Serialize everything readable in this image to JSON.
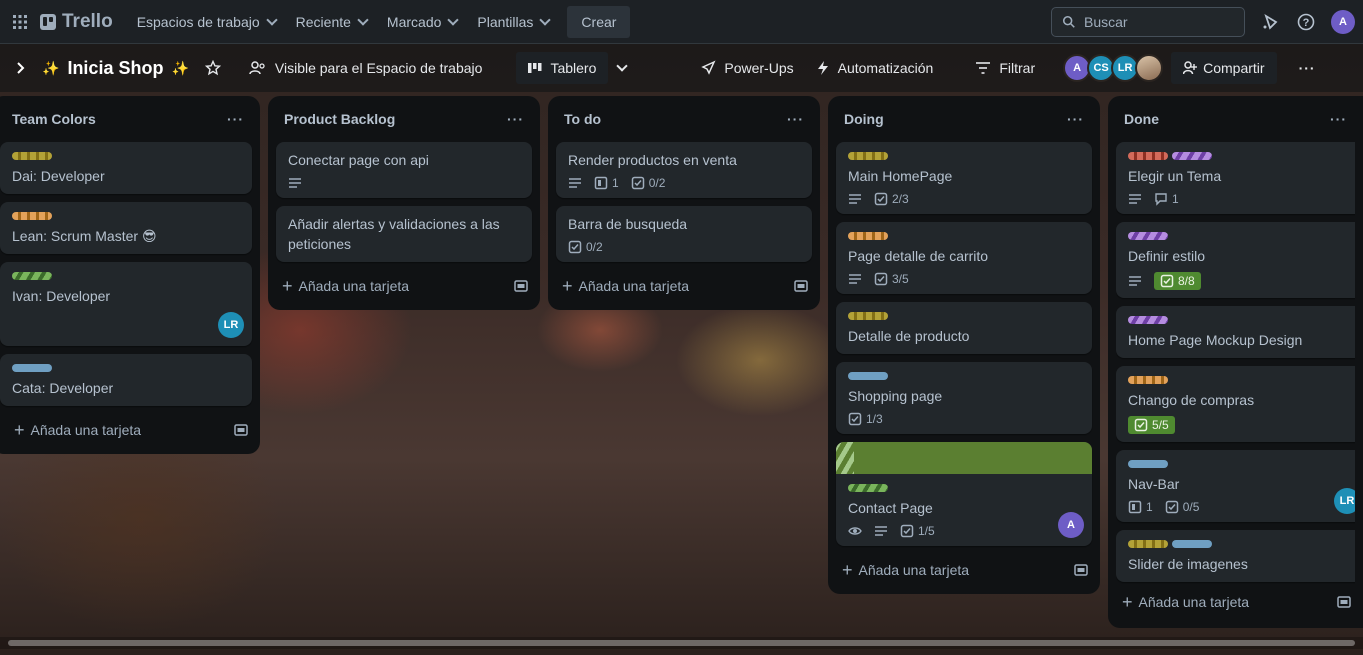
{
  "topnav": {
    "brand": "Trello",
    "menus": [
      "Espacios de trabajo",
      "Reciente",
      "Marcado",
      "Plantillas"
    ],
    "create_label": "Crear",
    "search_placeholder": "Buscar",
    "user_initial": "A"
  },
  "board": {
    "title": "Inicia Shop",
    "visibility_label": "Visible para el Espacio de trabajo",
    "view_label": "Tablero",
    "powerups_label": "Power-Ups",
    "automation_label": "Automatización",
    "filter_label": "Filtrar",
    "share_label": "Compartir",
    "members": [
      "A",
      "CS",
      "LR"
    ]
  },
  "add_card_label": "Añada una tarjeta",
  "lists": [
    {
      "title": "Team Colors",
      "cards": [
        {
          "title": "Dai: Developer"
        },
        {
          "title": "Lean: Scrum Master 😎"
        },
        {
          "title": "Ivan: Developer",
          "member": "LR"
        },
        {
          "title": "Cata: Developer"
        }
      ]
    },
    {
      "title": "Product Backlog",
      "cards": [
        {
          "title": "Conectar page con api"
        },
        {
          "title": "Añadir alertas y validaciones a las peticiones"
        }
      ]
    },
    {
      "title": "To do",
      "cards": [
        {
          "title": "Render productos en venta",
          "attachments": "1",
          "checklist": "0/2"
        },
        {
          "title": "Barra de busqueda",
          "checklist": "0/2"
        }
      ]
    },
    {
      "title": "Doing",
      "cards": [
        {
          "title": "Main HomePage",
          "checklist": "2/3"
        },
        {
          "title": "Page detalle de carrito",
          "checklist": "3/5"
        },
        {
          "title": "Detalle de producto"
        },
        {
          "title": "Shopping page",
          "checklist": "1/3"
        },
        {
          "title": "Contact Page",
          "checklist": "1/5",
          "member": "A"
        }
      ]
    },
    {
      "title": "Done",
      "cards": [
        {
          "title": "Elegir un Tema",
          "comments": "1"
        },
        {
          "title": "Definir estilo",
          "checklist": "8/8"
        },
        {
          "title": "Home Page Mockup Design"
        },
        {
          "title": "Chango de compras",
          "checklist": "5/5"
        },
        {
          "title": "Nav-Bar",
          "attachments": "1",
          "checklist": "0/5",
          "member": "LR"
        },
        {
          "title": "Slider de imagenes"
        }
      ]
    }
  ]
}
